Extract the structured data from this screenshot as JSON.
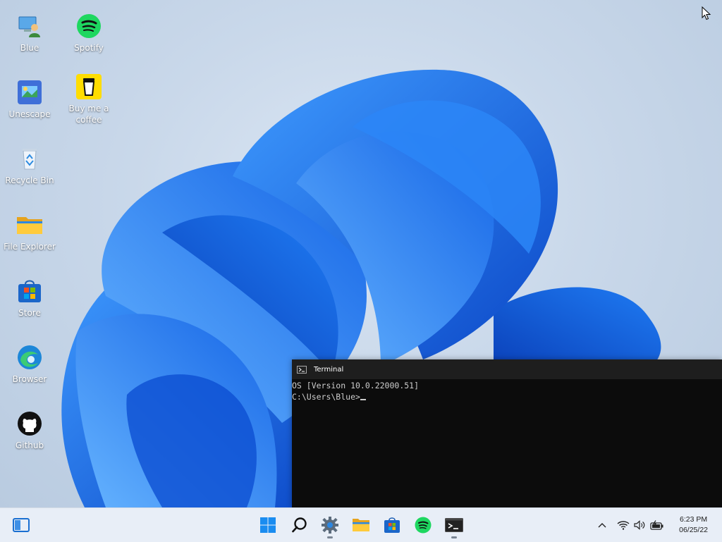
{
  "desktop": {
    "icons": [
      {
        "name": "blue",
        "label": "Blue",
        "icon": "user-computer-icon"
      },
      {
        "name": "spotify",
        "label": "Spotify",
        "icon": "spotify-icon"
      },
      {
        "name": "unescape",
        "label": "Unescape",
        "icon": "unescape-app-icon"
      },
      {
        "name": "buy-me-a-coffee",
        "label": "Buy me a\ncoffee",
        "icon": "coffee-cup-icon"
      },
      {
        "name": "recycle-bin",
        "label": "Recycle Bin",
        "icon": "recycle-bin-icon"
      },
      {
        "name": "file-explorer",
        "label": "File Explorer",
        "icon": "folder-icon"
      },
      {
        "name": "store",
        "label": "Store",
        "icon": "store-icon"
      },
      {
        "name": "browser",
        "label": "Browser",
        "icon": "edge-browser-icon"
      },
      {
        "name": "github",
        "label": "Github",
        "icon": "github-icon"
      }
    ]
  },
  "terminal": {
    "title": "Terminal",
    "lines": [
      "OS [Version 10.0.22000.51]",
      "",
      "C:\\Users\\Blue>"
    ],
    "colors": {
      "background": "#0c0c0c",
      "titlebar": "#1e1e1e",
      "text": "#cccccc"
    }
  },
  "taskbar": {
    "apps": [
      {
        "name": "start",
        "icon": "windows-start-icon",
        "running": false
      },
      {
        "name": "search",
        "icon": "search-icon",
        "running": false
      },
      {
        "name": "settings",
        "icon": "gear-icon",
        "running": true
      },
      {
        "name": "file-explorer",
        "icon": "folder-icon",
        "running": false
      },
      {
        "name": "store",
        "icon": "store-icon",
        "running": false
      },
      {
        "name": "spotify",
        "icon": "spotify-icon",
        "running": false
      },
      {
        "name": "terminal",
        "icon": "terminal-icon",
        "running": true
      }
    ],
    "tray": [
      "chevron-up-icon",
      "wifi-icon",
      "volume-icon",
      "battery-icon"
    ],
    "clock": {
      "time": "6:23 PM",
      "date": "06/25/22"
    }
  },
  "colors": {
    "accent": "#0f6cbd",
    "wallpaper_bloom": "#1a73e8",
    "spotify": "#1ed760",
    "coffee": "#ffdd00"
  }
}
